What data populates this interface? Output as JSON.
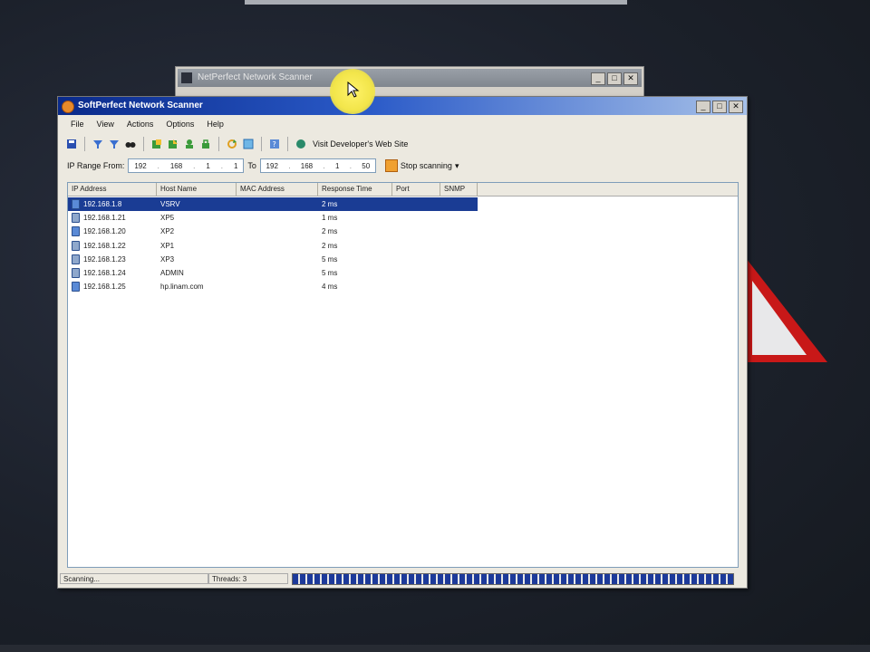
{
  "background_window": {
    "title": "NetPerfect Network Scanner",
    "controls": [
      "_",
      "□",
      "✕"
    ]
  },
  "window": {
    "title": "SoftPerfect Network Scanner",
    "controls": [
      "_",
      "□",
      "✕"
    ]
  },
  "menu": [
    "File",
    "View",
    "Actions",
    "Options",
    "Help"
  ],
  "toolbar": {
    "buttons": [
      "save-icon",
      "filter-icon",
      "filter-icon",
      "binoculars-icon",
      "export-icon",
      "export-icon",
      "user-icon",
      "lock-icon",
      "refresh-icon",
      "window-icon",
      "help-icon"
    ],
    "visit_label": "Visit Developer's Web Site"
  },
  "ip_range": {
    "from_label": "IP Range From:",
    "from": [
      "192",
      "168",
      "1",
      "1"
    ],
    "to_label": "To",
    "to": [
      "192",
      "168",
      "1",
      "50"
    ],
    "stop_label": "Stop scanning"
  },
  "columns": [
    "IP Address",
    "Host Name",
    "MAC Address",
    "Response Time",
    "Port",
    "SNMP"
  ],
  "rows": [
    {
      "ip": "192.168.1.8",
      "host": "VSRV",
      "mac": "",
      "response": "2 ms",
      "selected": true
    },
    {
      "ip": "192.168.1.21",
      "host": "XP5",
      "mac": "",
      "response": "1 ms",
      "selected": false
    },
    {
      "ip": "192.168.1.20",
      "host": "XP2",
      "mac": "",
      "response": "2 ms",
      "selected": false
    },
    {
      "ip": "192.168.1.22",
      "host": "XP1",
      "mac": "",
      "response": "2 ms",
      "selected": false
    },
    {
      "ip": "192.168.1.23",
      "host": "XP3",
      "mac": "",
      "response": "5 ms",
      "selected": false
    },
    {
      "ip": "192.168.1.24",
      "host": "ADMIN",
      "mac": "",
      "response": "5 ms",
      "selected": false
    },
    {
      "ip": "192.168.1.25",
      "host": "hp.linam.com",
      "mac": "",
      "response": "4 ms",
      "selected": false
    }
  ],
  "status": {
    "state": "Scanning...",
    "threads": "Threads: 3"
  },
  "colors": {
    "selection": "#1a3c94",
    "titlebar_start": "#0a2a8a",
    "progress": "#1d3a9a"
  }
}
